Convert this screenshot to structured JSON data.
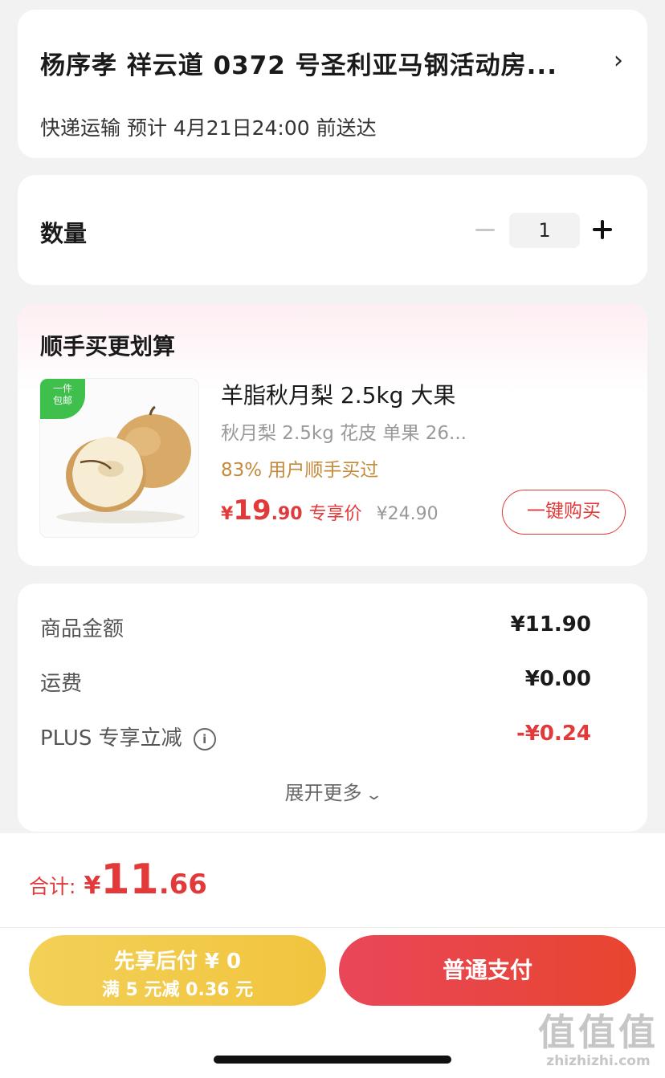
{
  "address": {
    "line": "杨序孝  祥云道 0372 号圣利亚马钢活动房...",
    "delivery": "快递运输 预计 4月21日24:00 前送达"
  },
  "quantity": {
    "label": "数量",
    "value": "1"
  },
  "upsell": {
    "title": "顺手买更划算",
    "badge": "一件\n包邮",
    "product_name": "羊脂秋月梨 2.5kg 大果",
    "product_spec": "秋月梨 2.5kg 花皮 单果 26...",
    "purchase_rate": "83% 用户顺手买过",
    "price_symbol": "¥",
    "price_int": "19",
    "price_dec": ".90",
    "price_tag": "专享价",
    "original_price": "¥24.90",
    "buy_button": "一键购买"
  },
  "summary": {
    "rows": [
      {
        "label": "商品金额",
        "value": "¥11.90"
      },
      {
        "label": "运费",
        "value": "¥0.00"
      },
      {
        "label": "PLUS 专享立减",
        "value": "-¥0.24"
      }
    ],
    "expand": "展开更多"
  },
  "footer": {
    "total_label": "合计:",
    "total_symbol": "¥",
    "total_int": "11",
    "total_dec": ".66",
    "paylater_title": "先享后付 ¥ 0",
    "paylater_sub": "满 5 元减 0.36 元",
    "pay_button": "普通支付"
  },
  "watermark": {
    "logo": "值值值",
    "url": "zhizhizhi.com"
  },
  "colors": {
    "accent": "#e2393a",
    "gold": "#f2c94c",
    "green_badge": "#3fbf4c",
    "rate_text": "#c48a3a"
  }
}
